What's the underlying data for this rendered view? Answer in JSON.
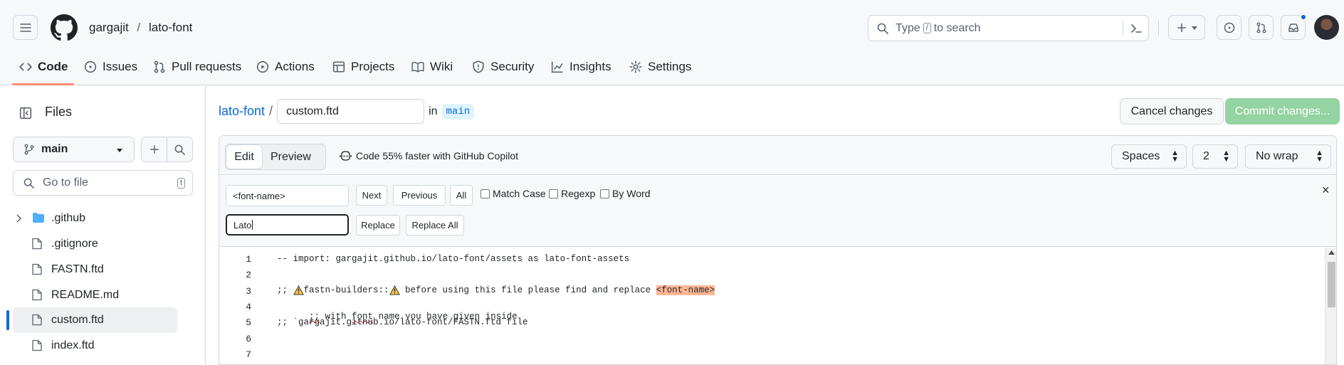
{
  "header": {
    "owner": "gargajit",
    "separator": "/",
    "repo": "lato-font",
    "search": {
      "prefix": "Type",
      "key": "/",
      "suffix": "to search"
    },
    "plus_label": "+"
  },
  "nav_tabs": [
    {
      "label": "Code",
      "icon": "code-icon",
      "active": true
    },
    {
      "label": "Issues",
      "icon": "issue-opened-icon"
    },
    {
      "label": "Pull requests",
      "icon": "git-pull-request-icon"
    },
    {
      "label": "Actions",
      "icon": "play-icon"
    },
    {
      "label": "Projects",
      "icon": "table-icon"
    },
    {
      "label": "Wiki",
      "icon": "book-icon"
    },
    {
      "label": "Security",
      "icon": "shield-icon"
    },
    {
      "label": "Insights",
      "icon": "graph-icon"
    },
    {
      "label": "Settings",
      "icon": "gear-icon"
    }
  ],
  "sidebar": {
    "title": "Files",
    "branch": "main",
    "goto_placeholder": "Go to file",
    "goto_shortcut": "t",
    "items": [
      {
        "label": ".github",
        "type": "folder"
      },
      {
        "label": ".gitignore",
        "type": "file"
      },
      {
        "label": "FASTN.ftd",
        "type": "file"
      },
      {
        "label": "README.md",
        "type": "file"
      },
      {
        "label": "custom.ftd",
        "type": "file",
        "selected": true
      },
      {
        "label": "index.ftd",
        "type": "file"
      }
    ]
  },
  "path": {
    "repo_link": "lato-font",
    "separator": "/",
    "filename": "custom.ftd",
    "in_text": "in",
    "branch": "main"
  },
  "actions": {
    "cancel": "Cancel changes",
    "commit": "Commit changes..."
  },
  "editor": {
    "tab_edit": "Edit",
    "tab_preview": "Preview",
    "copilot": "Code 55% faster with GitHub Copilot",
    "indent_mode": "Spaces",
    "indent_size": "2",
    "wrap_mode": "No wrap"
  },
  "findbar": {
    "find_value": "<font-name>",
    "replace_value": "Lato",
    "next": "Next",
    "previous": "Previous",
    "all": "All",
    "match_case": "Match Case",
    "regexp": "Regexp",
    "by_word": "By Word",
    "replace": "Replace",
    "replace_all": "Replace All",
    "close": "×"
  },
  "code": {
    "line_numbers": [
      "1",
      "2",
      "3",
      "4",
      "5",
      "6",
      "7"
    ],
    "line1": "-- import: gargajit.github.io/lato-font/assets as lato-font-assets",
    "line3_a": ";; ",
    "line3_b": "fastn-builders::",
    "line3_c": " before using this file please find and replace ",
    "line3_match": "<font-name>",
    "line4_a": ";;",
    "line4_b": " with ",
    "line4_c": "font",
    "line4_d": " name you have given inside",
    "line5": ";; `gargajit.github.io/lato-font/FASTN.ftd file"
  },
  "colors": {
    "accent_blue": "#0969da",
    "commit_green": "#94d3a2",
    "match_highlight": "#ffb693",
    "tab_underline": "#fd8c73"
  }
}
